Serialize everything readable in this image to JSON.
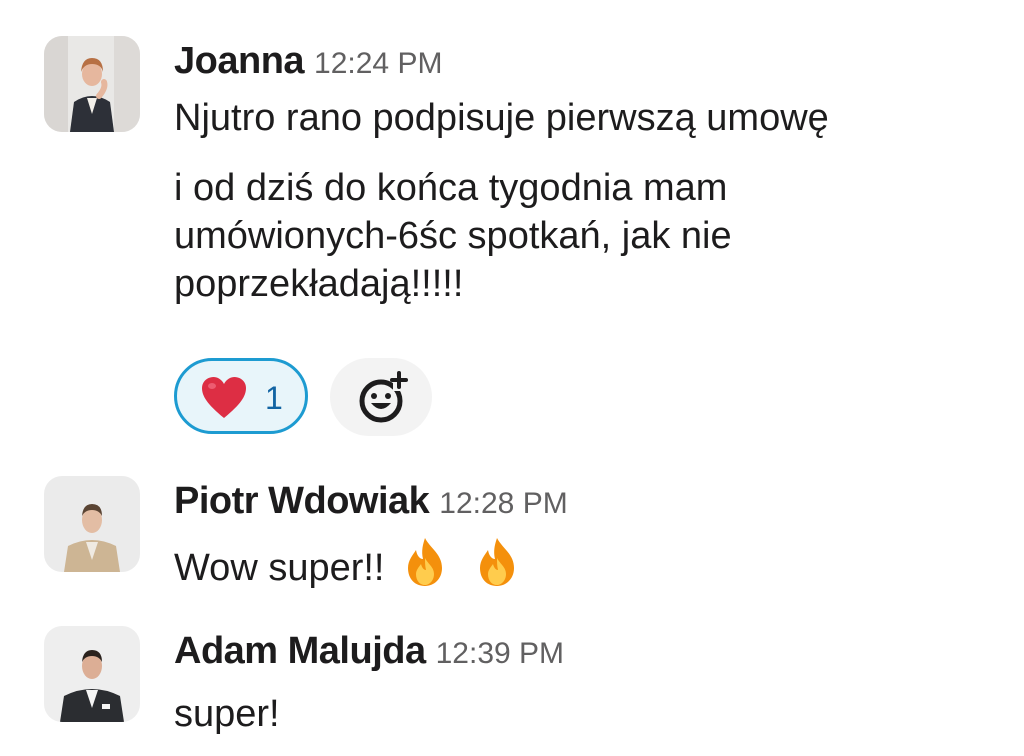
{
  "messages": [
    {
      "author": "Joanna",
      "time": "12:24 PM",
      "lines": [
        "Njutro rano podpisuje pierwszą umowę",
        "i od dziś do końca tygodnia mam umówionych-6śc spotkań, jak nie poprzekładają!!!!!"
      ],
      "reactions": [
        {
          "emoji": "heart-emoji",
          "count": "1"
        }
      ]
    },
    {
      "author": "Piotr Wdowiak",
      "time": "12:28 PM",
      "text": "Wow super!!",
      "emojis": [
        "fire-emoji",
        "fire-emoji"
      ]
    },
    {
      "author": "Adam Malujda",
      "time": "12:39 PM",
      "text": "super!"
    }
  ],
  "colors": {
    "reaction_border": "#1d9bd1",
    "reaction_bg": "#e8f5fa",
    "reaction_count": "#1264a3",
    "timestamp": "#616061"
  }
}
